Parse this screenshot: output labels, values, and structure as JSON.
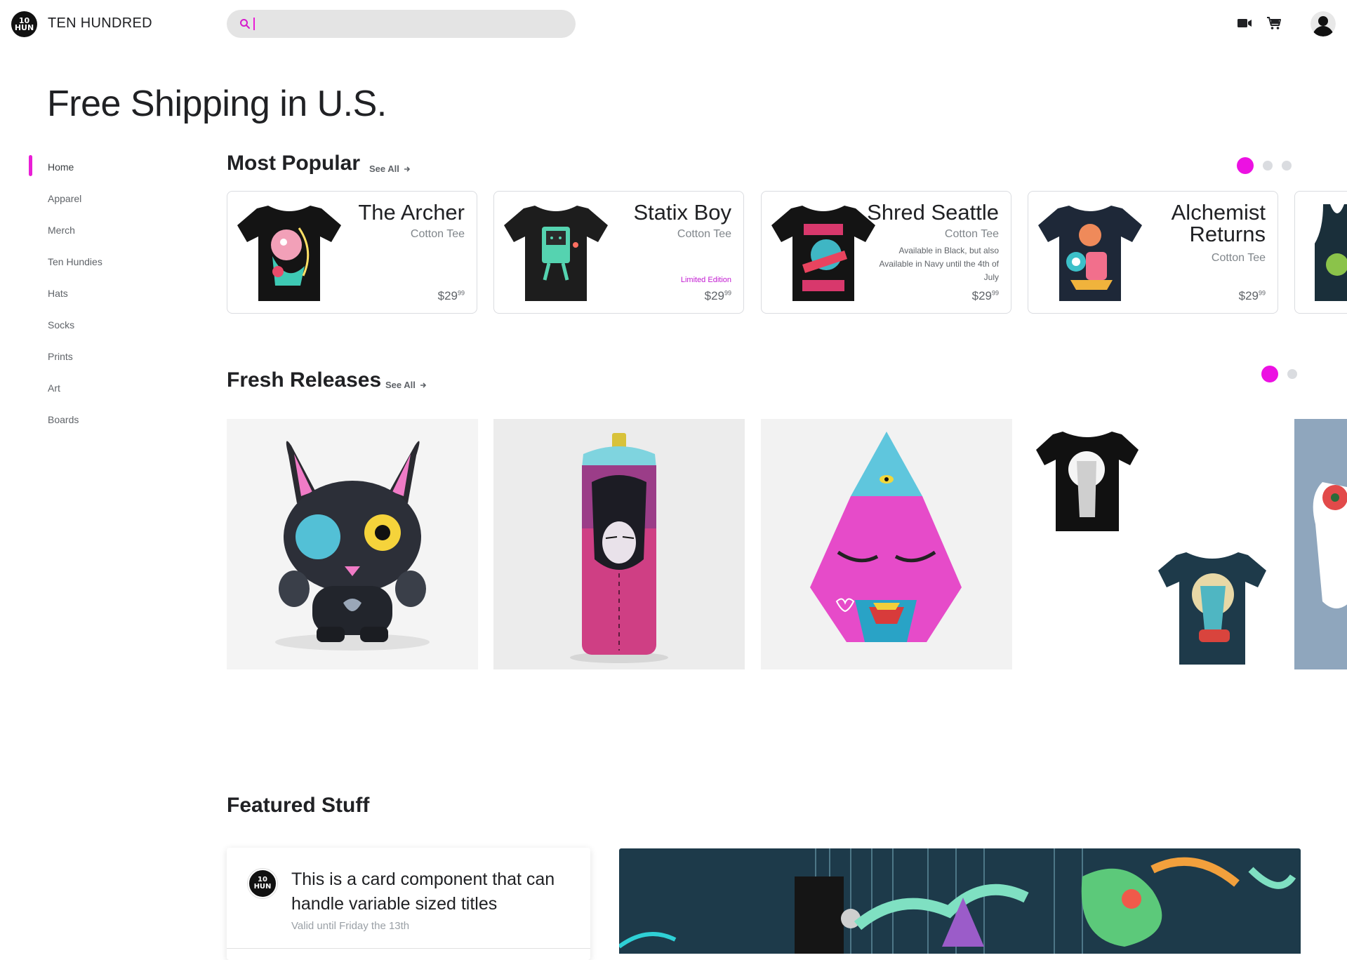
{
  "header": {
    "logo_text": "10 HUN",
    "brand": "TEN HUNDRED",
    "search_value": "",
    "icons": [
      "search-icon",
      "video-camera-icon",
      "cart-icon",
      "account-icon"
    ]
  },
  "hero": {
    "title": "Free Shipping in U.S."
  },
  "sidebar": {
    "items": [
      {
        "label": "Home",
        "active": true
      },
      {
        "label": "Apparel"
      },
      {
        "label": "Merch"
      },
      {
        "label": "Ten Hundies"
      },
      {
        "label": "Hats"
      },
      {
        "label": "Socks"
      },
      {
        "label": "Prints"
      },
      {
        "label": "Art"
      },
      {
        "label": "Boards"
      }
    ]
  },
  "most_popular": {
    "title": "Most Popular",
    "see_all": "See All",
    "pages": 3,
    "active_page": 1,
    "cards": [
      {
        "title": "The Archer",
        "subtitle": "Cotton Tee",
        "price": "$29",
        "cents": "99",
        "shirt_color": "#141414"
      },
      {
        "title": "Statix Boy",
        "subtitle": "Cotton Tee",
        "badge": "Limited Edition",
        "price": "$29",
        "cents": "99",
        "shirt_color": "#1d1d1d"
      },
      {
        "title": "Shred Seattle",
        "subtitle": "Cotton Tee",
        "note": "Available in Black, but also Available in Navy until the 4th of July",
        "price": "$29",
        "cents": "99",
        "shirt_color": "#141414"
      },
      {
        "title": "Alchemist Returns",
        "subtitle": "Cotton Tee",
        "price": "$29",
        "cents": "99",
        "shirt_color": "#1e2838"
      }
    ]
  },
  "fresh_releases": {
    "title": "Fresh Releases",
    "see_all": "See All",
    "pages": 2,
    "active_page": 1
  },
  "featured": {
    "title": "Featured Stuff",
    "card_logo": "10 HUN",
    "card_title": "This is a card component that can handle variable sized titles",
    "card_subtitle": "Valid until Friday the 13th"
  },
  "colors": {
    "accent": "#ec11e2",
    "text": "#202124",
    "muted": "#5f6368"
  }
}
